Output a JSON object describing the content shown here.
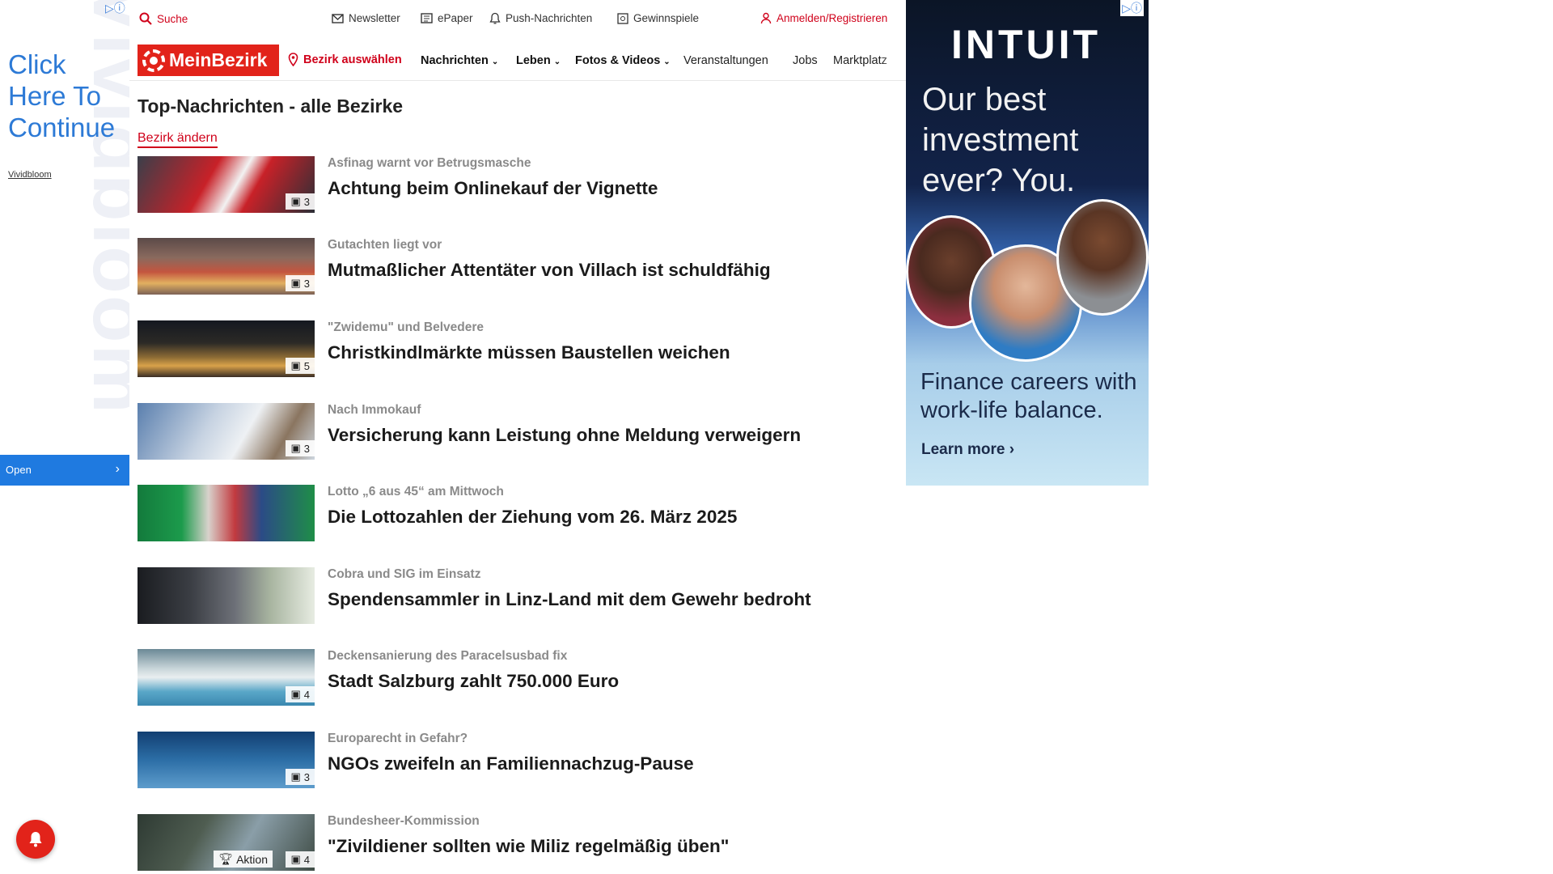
{
  "left_ad": {
    "cta_text": "Click Here To Continue",
    "brand": "Vividbloom",
    "watermark": "Vividbloom",
    "open_label": "Open"
  },
  "utility_bar": {
    "search": "Suche",
    "newsletter": "Newsletter",
    "epaper": "ePaper",
    "push": "Push-Nachrichten",
    "games": "Gewinnspiele",
    "login": "Anmelden/Registrieren"
  },
  "nav": {
    "logo_text": "MeinBezirk",
    "choose_district": "Bezirk auswählen",
    "items": [
      "Nachrichten",
      "Leben",
      "Fotos & Videos",
      "Veranstaltungen",
      "Jobs",
      "Marktplatz"
    ]
  },
  "page": {
    "title": "Top-Nachrichten - alle Bezirke",
    "change_district": "Bezirk ändern"
  },
  "articles": [
    {
      "kicker": "Asfinag warnt vor Betrugsmasche",
      "headline": "Achtung beim Onlinekauf der Vignette",
      "photos": "3"
    },
    {
      "kicker": "Gutachten liegt vor",
      "headline": "Mutmaßlicher Attentäter von Villach ist schuldfähig",
      "photos": "3"
    },
    {
      "kicker": "\"Zwidemu\" und Belvedere",
      "headline": "Christkindlmärkte müssen Baustellen weichen",
      "photos": "5"
    },
    {
      "kicker": "Nach Immokauf",
      "headline": "Versicherung kann Leistung ohne Meldung verweigern",
      "photos": "3"
    },
    {
      "kicker": "Lotto „6 aus 45“ am Mittwoch",
      "headline": "Die Lottozahlen der Ziehung vom 26. März 2025",
      "photos": ""
    },
    {
      "kicker": "Cobra und SIG im Einsatz",
      "headline": "Spendensammler in Linz-Land mit dem Gewehr bedroht",
      "photos": ""
    },
    {
      "kicker": "Deckensanierung des Paracelsusbad fix",
      "headline": "Stadt Salzburg zahlt 750.000 Euro",
      "photos": "4"
    },
    {
      "kicker": "Europarecht in Gefahr?",
      "headline": "NGOs zweifeln an Familiennachzug-Pause",
      "photos": "3"
    },
    {
      "kicker": "Bundesheer-Kommission",
      "headline": "\"Zivildiener sollten wie Miliz regelmäßig üben\"",
      "photos": "4",
      "aktion": "Aktion"
    }
  ],
  "right_ad": {
    "brand": "INTUIT",
    "tagline": "Our best investment ever? You.",
    "subline": "Finance careers with work-life balance.",
    "cta": "Learn more ›"
  },
  "colors": {
    "brand_red": "#e2231a",
    "link_red": "#d0021b",
    "ad_blue": "#2d7ad6"
  }
}
